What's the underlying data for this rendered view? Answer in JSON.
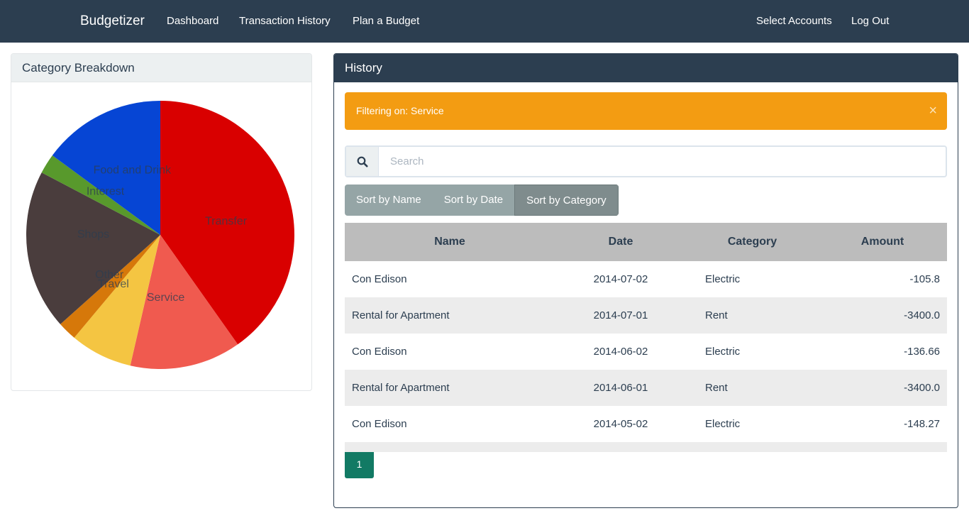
{
  "nav": {
    "brand": "Budgetizer",
    "dashboard": "Dashboard",
    "transaction_history": "Transaction History",
    "plan_budget": "Plan a Budget",
    "select_accounts": "Select Accounts",
    "log_out": "Log Out"
  },
  "category_panel": {
    "title": "Category Breakdown"
  },
  "chart_data": {
    "type": "pie",
    "slices": [
      {
        "label": "Transfer",
        "value": 40.2,
        "color": "#d90000"
      },
      {
        "label": "Service",
        "value": 13.4,
        "color": "#f05a4f"
      },
      {
        "label": "Travel",
        "value": 7.5,
        "color": "#f4c542"
      },
      {
        "label": "Other",
        "value": 2.3,
        "color": "#d6780a"
      },
      {
        "label": "Shops",
        "value": 19.3,
        "color": "#4a3d3d"
      },
      {
        "label": "Interest",
        "value": 2.4,
        "color": "#58992c"
      },
      {
        "label": "Food and Drink",
        "value": 14.9,
        "color": "#0645d4"
      }
    ]
  },
  "history_panel": {
    "title": "History",
    "alert": "Filtering on: Service",
    "alert_close": "×",
    "search_placeholder": "Search",
    "sort_buttons": [
      "Sort by Name",
      "Sort by Date",
      "Sort by Category"
    ],
    "active_sort": "Sort by Category",
    "columns": [
      "Name",
      "Date",
      "Category",
      "Amount"
    ],
    "rows": [
      {
        "name": "Con Edison",
        "date": "2014-07-02",
        "category": "Electric",
        "amount": "-105.8"
      },
      {
        "name": "Rental for Apartment",
        "date": "2014-07-01",
        "category": "Rent",
        "amount": "-3400.0"
      },
      {
        "name": "Con Edison",
        "date": "2014-06-02",
        "category": "Electric",
        "amount": "-136.66"
      },
      {
        "name": "Rental for Apartment",
        "date": "2014-06-01",
        "category": "Rent",
        "amount": "-3400.0"
      },
      {
        "name": "Con Edison",
        "date": "2014-05-02",
        "category": "Electric",
        "amount": "-148.27"
      }
    ],
    "page": "1"
  },
  "colors": {
    "navbar": "#2c3e50",
    "alert": "#f39c12",
    "pagination": "#127a64",
    "sort_button": "#95a5a6",
    "sort_button_active": "#7f8c8d"
  }
}
